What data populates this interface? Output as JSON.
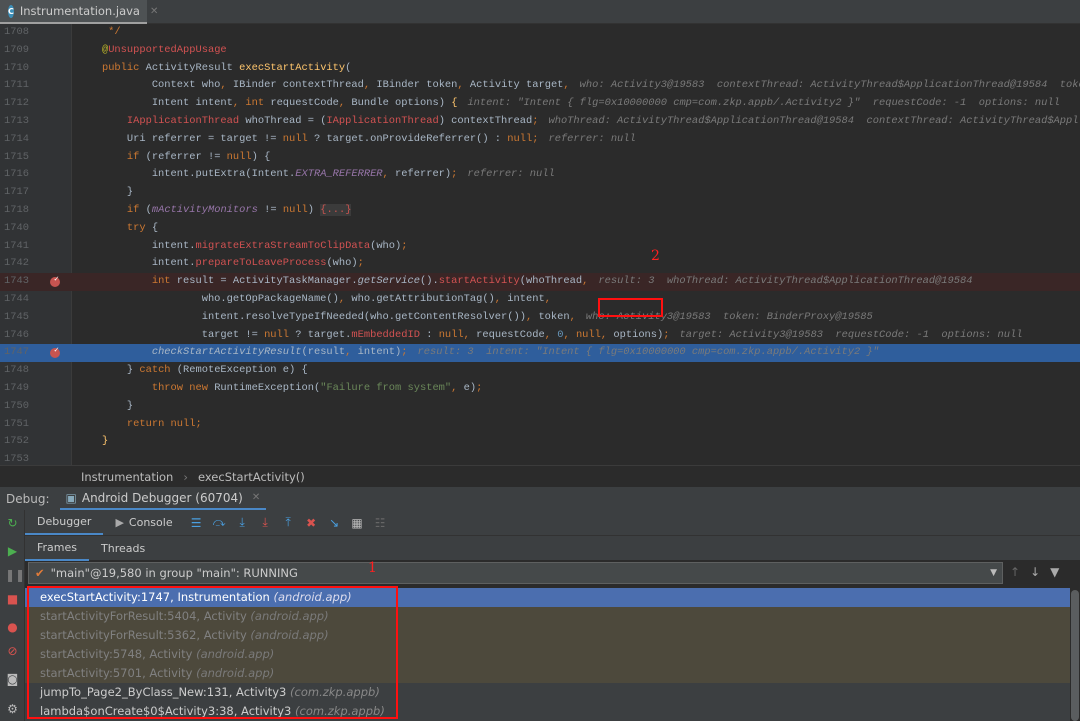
{
  "file_tab": {
    "name": "Instrumentation.java",
    "icon": "java-class-icon",
    "icon_letter": "C"
  },
  "code_lines": [
    {
      "num": "1708",
      "tokens": [
        [
          "     */",
          "k"
        ]
      ]
    },
    {
      "num": "1709",
      "tokens": [
        [
          "    @",
          "s2"
        ],
        [
          "UnsupportedAppUsage",
          "r"
        ]
      ]
    },
    {
      "num": "1710",
      "tokens": [
        [
          "    ",
          ""
        ],
        [
          "public ",
          "k"
        ],
        [
          "ActivityResult ",
          ""
        ],
        [
          "execStartActivity",
          "m"
        ],
        [
          "(",
          ""
        ]
      ]
    },
    {
      "num": "1711",
      "tokens": [
        [
          "            Context who",
          ""
        ],
        [
          ", ",
          "k"
        ],
        [
          "IBinder contextThread",
          ""
        ],
        [
          ", ",
          "k"
        ],
        [
          "IBinder token",
          ""
        ],
        [
          ", ",
          "k"
        ],
        [
          "Activity target",
          ""
        ],
        [
          ",",
          "k"
        ]
      ],
      "hint": "who: Activity3@19583  contextThread: ActivityThread$ApplicationThread@19584  token"
    },
    {
      "num": "1712",
      "tokens": [
        [
          "            Intent intent",
          ""
        ],
        [
          ", ",
          "k"
        ],
        [
          "int ",
          "k"
        ],
        [
          "requestCode",
          ""
        ],
        [
          ", ",
          "k"
        ],
        [
          "Bundle options) ",
          ""
        ],
        [
          "{",
          "m"
        ]
      ],
      "hint": "intent: \"Intent { flg=0x10000000 cmp=com.zkp.appb/.Activity2 }\"  requestCode: -1  options: null"
    },
    {
      "num": "1713",
      "tokens": [
        [
          "        ",
          ""
        ],
        [
          "IApplicationThread",
          "r"
        ],
        [
          " whoThread = (",
          ""
        ],
        [
          "IApplicationThread",
          "r"
        ],
        [
          ") contextThread",
          ""
        ],
        [
          ";",
          "k"
        ]
      ],
      "hint": "whoThread: ActivityThread$ApplicationThread@19584  contextThread: ActivityThread$Appl"
    },
    {
      "num": "1714",
      "tokens": [
        [
          "        Uri referrer = target != ",
          ""
        ],
        [
          "null",
          "k"
        ],
        [
          " ? target.onProvideReferrer() : ",
          ""
        ],
        [
          "null;",
          "k"
        ]
      ],
      "hint": "referrer: null"
    },
    {
      "num": "1715",
      "tokens": [
        [
          "        ",
          ""
        ],
        [
          "if ",
          "k"
        ],
        [
          "(referrer != ",
          ""
        ],
        [
          "null",
          "k"
        ],
        [
          ") {",
          ""
        ]
      ]
    },
    {
      "num": "1716",
      "tokens": [
        [
          "            intent.putExtra(Intent.",
          ""
        ],
        [
          "EXTRA_REFERRER",
          "st"
        ],
        [
          ", ",
          "k"
        ],
        [
          "referrer)",
          ""
        ],
        [
          ";",
          "k"
        ]
      ],
      "hint": "referrer: null"
    },
    {
      "num": "1717",
      "tokens": [
        [
          "        }",
          ""
        ]
      ]
    },
    {
      "num": "1718",
      "tokens": [
        [
          "        ",
          ""
        ],
        [
          "if ",
          "k"
        ],
        [
          "(",
          ""
        ],
        [
          "mActivityMonitors",
          "st2"
        ],
        [
          " != ",
          ""
        ],
        [
          "null",
          "k"
        ],
        [
          ") ",
          ""
        ],
        [
          "{...}",
          "fold"
        ]
      ]
    },
    {
      "num": "1740",
      "tokens": [
        [
          "        ",
          ""
        ],
        [
          "try ",
          "k"
        ],
        [
          "{",
          ""
        ]
      ]
    },
    {
      "num": "1741",
      "tokens": [
        [
          "            intent.",
          ""
        ],
        [
          "migrateExtraStreamToClipData",
          "r"
        ],
        [
          "(who)",
          ""
        ],
        [
          ";",
          "k"
        ]
      ]
    },
    {
      "num": "1742",
      "tokens": [
        [
          "            intent.",
          ""
        ],
        [
          "prepareToLeaveProcess",
          "r"
        ],
        [
          "(who)",
          ""
        ],
        [
          ";",
          "k"
        ]
      ]
    },
    {
      "num": "1743",
      "bp": true,
      "tokens": [
        [
          "            ",
          ""
        ],
        [
          "int ",
          "k"
        ],
        [
          "result = ActivityTaskManager.",
          ""
        ],
        [
          "getService",
          "it"
        ],
        [
          "().",
          ""
        ],
        [
          "startActivity",
          "r"
        ],
        [
          "(whoThread",
          ""
        ],
        [
          ",",
          "k"
        ]
      ],
      "hint": "result: 3  whoThread: ActivityThread$ApplicationThread@19584"
    },
    {
      "num": "1744",
      "tokens": [
        [
          "                    who.getOpPackageName()",
          ""
        ],
        [
          ", ",
          "k"
        ],
        [
          "who.getAttributionTag()",
          ""
        ],
        [
          ", ",
          "k"
        ],
        [
          "intent",
          ""
        ],
        [
          ",",
          "k"
        ]
      ]
    },
    {
      "num": "1745",
      "tokens": [
        [
          "                    intent.resolveTypeIfNeeded(who.getContentResolver())",
          ""
        ],
        [
          ", ",
          "k"
        ],
        [
          "token",
          ""
        ],
        [
          ",",
          "k"
        ]
      ],
      "hint": "who: Activity3@19583  token: BinderProxy@19585"
    },
    {
      "num": "1746",
      "tokens": [
        [
          "                    target != ",
          ""
        ],
        [
          "null",
          "k"
        ],
        [
          " ? target.",
          ""
        ],
        [
          "mEmbeddedID",
          "r"
        ],
        [
          " : ",
          ""
        ],
        [
          "null",
          "k"
        ],
        [
          ", ",
          "k"
        ],
        [
          "requestCode",
          ""
        ],
        [
          ", ",
          "k"
        ],
        [
          "0",
          "n"
        ],
        [
          ", ",
          "k"
        ],
        [
          "null",
          "k"
        ],
        [
          ", ",
          "k"
        ],
        [
          "options)",
          ""
        ],
        [
          ";",
          "k"
        ]
      ],
      "hint": "target: Activity3@19583  requestCode: -1  options: null"
    },
    {
      "num": "1747",
      "bp": true,
      "current": true,
      "tokens": [
        [
          "            ",
          ""
        ],
        [
          "checkStartActivityResult",
          "it"
        ],
        [
          "(result",
          ""
        ],
        [
          ", ",
          "k"
        ],
        [
          "intent)",
          ""
        ],
        [
          ";",
          "k"
        ]
      ],
      "hint": "result: 3  intent: \"Intent { flg=0x10000000 cmp=com.zkp.appb/.Activity2 }\""
    },
    {
      "num": "1748",
      "tokens": [
        [
          "        } ",
          ""
        ],
        [
          "catch ",
          "k"
        ],
        [
          "(RemoteException e) {",
          ""
        ]
      ]
    },
    {
      "num": "1749",
      "tokens": [
        [
          "            ",
          ""
        ],
        [
          "throw new ",
          "k"
        ],
        [
          "RuntimeException(",
          ""
        ],
        [
          "\"Failure from system\"",
          "s"
        ],
        [
          ", ",
          "k"
        ],
        [
          "e)",
          ""
        ],
        [
          ";",
          "k"
        ]
      ]
    },
    {
      "num": "1750",
      "tokens": [
        [
          "        }",
          ""
        ]
      ]
    },
    {
      "num": "1751",
      "tokens": [
        [
          "        ",
          ""
        ],
        [
          "return null;",
          "k"
        ]
      ]
    },
    {
      "num": "1752",
      "tokens": [
        [
          "    ",
          ""
        ],
        [
          "}",
          "m"
        ]
      ]
    },
    {
      "num": "1753",
      "tokens": []
    }
  ],
  "annotations": {
    "label_1": "1",
    "label_2": "2",
    "highlight_color": "#ff1010"
  },
  "breadcrumb": {
    "items": [
      "Instrumentation",
      "execStartActivity()"
    ],
    "separator": "›"
  },
  "debug_bar": {
    "label": "Debug:",
    "tab": "Android Debugger (60704)"
  },
  "toolbar": {
    "tabs": [
      "Debugger",
      "Console"
    ],
    "icons": [
      "menu-icon",
      "step-over-icon",
      "step-into-icon",
      "force-step-into-icon",
      "step-out-icon",
      "drop-frame-icon",
      "run-to-cursor-icon",
      "evaluate-expression-icon",
      "trace-icon"
    ]
  },
  "subtabs": [
    "Frames",
    "Threads"
  ],
  "thread": {
    "value": "\"main\"@19,580 in group \"main\": RUNNING"
  },
  "frames": [
    {
      "text": "execStartActivity:1747, Instrumentation ",
      "pkg": "(android.app)",
      "kind": "sel"
    },
    {
      "text": "startActivityForResult:5404, Activity ",
      "pkg": "(android.app)",
      "kind": "lib"
    },
    {
      "text": "startActivityForResult:5362, Activity ",
      "pkg": "(android.app)",
      "kind": "lib"
    },
    {
      "text": "startActivity:5748, Activity ",
      "pkg": "(android.app)",
      "kind": "lib"
    },
    {
      "text": "startActivity:5701, Activity ",
      "pkg": "(android.app)",
      "kind": "lib"
    },
    {
      "text": "jumpTo_Page2_ByClass_New:131, Activity3 ",
      "pkg": "(com.zkp.appb)",
      "kind": ""
    },
    {
      "text": "lambda$onCreate$0$Activity3:38, Activity3 ",
      "pkg": "(com.zkp.appb)",
      "kind": ""
    }
  ]
}
